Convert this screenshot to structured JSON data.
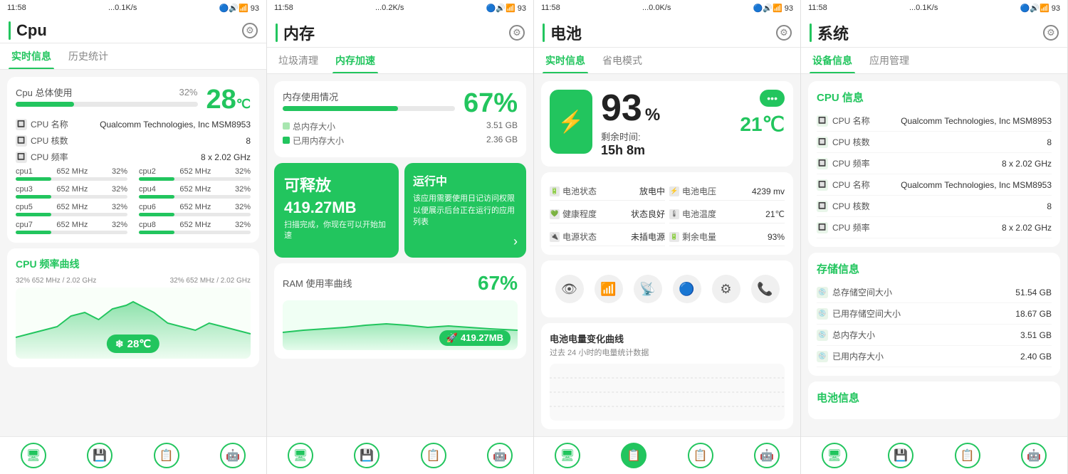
{
  "panels": [
    {
      "id": "cpu",
      "status": {
        "time": "11:58",
        "network": "...0.1K/s",
        "battery_icon": "93",
        "icons": "🔵🔊📶"
      },
      "header": {
        "title": "Cpu",
        "settings_label": "⚙"
      },
      "tabs": [
        {
          "label": "实时信息",
          "active": true
        },
        {
          "label": "历史统计",
          "active": false
        }
      ],
      "usage_card": {
        "label": "Cpu 总体使用",
        "pct_text": "32%",
        "pct_num": 32,
        "temp": "28",
        "temp_unit": "℃",
        "info": [
          {
            "label": "CPU 名称",
            "value": "Qualcomm Technologies, Inc MSM8953"
          },
          {
            "label": "CPU 核数",
            "value": "8"
          },
          {
            "label": "CPU 频率",
            "value": "8 x 2.02 GHz"
          }
        ],
        "cores": [
          {
            "name": "cpu1",
            "freq": "652 MHz",
            "pct": "32%"
          },
          {
            "name": "cpu2",
            "freq": "652 MHz",
            "pct": "32%"
          },
          {
            "name": "cpu3",
            "freq": "652 MHz",
            "pct": "32%"
          },
          {
            "name": "cpu4",
            "freq": "652 MHz",
            "pct": "32%"
          },
          {
            "name": "cpu5",
            "freq": "652 MHz",
            "pct": "32%"
          },
          {
            "name": "cpu6",
            "freq": "652 MHz",
            "pct": "32%"
          },
          {
            "name": "cpu7",
            "freq": "652 MHz",
            "pct": "32%"
          },
          {
            "name": "cpu8",
            "freq": "652 MHz",
            "pct": "32%"
          }
        ]
      },
      "freq_chart": {
        "title": "CPU 频率曲线",
        "label1": "32%  652 MHz / 2.02 GHz",
        "label2": "32%  652 MHz / 2.02 GHz",
        "temp_badge": "28℃"
      },
      "nav_icons": [
        "🖥",
        "💾",
        "📋",
        "🤖"
      ]
    },
    {
      "id": "memory",
      "status": {
        "time": "11:58",
        "network": "...0.2K/s"
      },
      "header": {
        "title": "内存",
        "settings_label": "⚙"
      },
      "tabs": [
        {
          "label": "垃圾清理",
          "active": false
        },
        {
          "label": "内存加速",
          "active": true
        }
      ],
      "usage_card": {
        "label": "内存使用情况",
        "pct_text": "67%",
        "pct_num": 67,
        "rows": [
          {
            "dot_color": "#a8e6b0",
            "label": "总内存大小",
            "value": "3.51 GB"
          },
          {
            "dot_color": "#22c55e",
            "label": "已用内存大小",
            "value": "2.36 GB"
          }
        ]
      },
      "release_card": {
        "title": "可释放",
        "mb": "419.27MB",
        "desc": "扫描完成，你现在可以开始加速",
        "running_title": "运行中",
        "running_desc": "该应用需要使用日记访问权限以便展示后台正在运行的应用列表"
      },
      "ram_chart": {
        "title": "RAM 使用率曲线",
        "pct": "67%",
        "badge": "419.27MB"
      },
      "nav_icons": [
        "🖥",
        "💾",
        "📋",
        "🤖"
      ]
    },
    {
      "id": "battery",
      "status": {
        "time": "11:58",
        "network": "...0.0K/s"
      },
      "header": {
        "title": "电池",
        "settings_label": "⚙"
      },
      "tabs": [
        {
          "label": "实时信息",
          "active": true
        },
        {
          "label": "省电模式",
          "active": false
        }
      ],
      "battery_card": {
        "pct": "93",
        "pct_unit": "%",
        "temp": "21℃",
        "remain_label": "剩余时间:",
        "remain_value": "15h 8m"
      },
      "stats": [
        {
          "label": "电池状态",
          "value": "放电中",
          "icon": "🔋"
        },
        {
          "label": "电池电压",
          "value": "4239 mv",
          "icon": "⚡"
        },
        {
          "label": "健康程度",
          "value": "状态良好",
          "icon": "💚"
        },
        {
          "label": "电池温度",
          "value": "21℃",
          "icon": "🌡"
        },
        {
          "label": "电源状态",
          "value": "未插电源",
          "icon": "🔌"
        },
        {
          "label": "剩余电量",
          "value": "93%",
          "icon": "🔋"
        }
      ],
      "toggles": [
        {
          "icon": "👁",
          "active": false
        },
        {
          "icon": "📶",
          "active": false
        },
        {
          "icon": "📡",
          "active": false
        },
        {
          "icon": "🔵",
          "active": false
        },
        {
          "icon": "⚙",
          "active": false
        },
        {
          "icon": "📞",
          "active": false
        }
      ],
      "chart": {
        "title": "电池电量变化曲线",
        "subtitle": "过去 24 小时的电量统计数据"
      },
      "nav_icons": [
        "🖥",
        "💾",
        "📋",
        "🤖"
      ]
    },
    {
      "id": "system",
      "status": {
        "time": "11:58",
        "network": "...0.1K/s"
      },
      "header": {
        "title": "系统",
        "settings_label": "⚙"
      },
      "tabs": [
        {
          "label": "设备信息",
          "active": true
        },
        {
          "label": "应用管理",
          "active": false
        }
      ],
      "cpu_info": {
        "title": "CPU 信息",
        "rows": [
          {
            "label": "CPU 名称",
            "value": "Qualcomm Technologies, Inc MSM8953"
          },
          {
            "label": "CPU 核数",
            "value": "8"
          },
          {
            "label": "CPU 频率",
            "value": "8 x 2.02 GHz"
          },
          {
            "label": "CPU 名称",
            "value": "Qualcomm Technologies, Inc MSM8953"
          },
          {
            "label": "CPU 核数",
            "value": "8"
          },
          {
            "label": "CPU 频率",
            "value": "8 x 2.02 GHz"
          }
        ]
      },
      "storage_info": {
        "title": "存储信息",
        "rows": [
          {
            "label": "总存储空间大小",
            "value": "51.54 GB"
          },
          {
            "label": "已用存储空间大小",
            "value": "18.67 GB"
          },
          {
            "label": "总内存大小",
            "value": "3.51 GB"
          },
          {
            "label": "已用内存大小",
            "value": "2.40 GB"
          }
        ]
      },
      "battery_info": {
        "title": "电池信息"
      },
      "nav_icons": [
        "🖥",
        "💾",
        "📋",
        "🤖"
      ]
    }
  ],
  "colors": {
    "green": "#22c55e",
    "light_green": "#a8e6b0",
    "bg": "#f5f5f5",
    "white": "#ffffff",
    "text_dark": "#222222",
    "text_mid": "#555555",
    "text_light": "#888888"
  }
}
